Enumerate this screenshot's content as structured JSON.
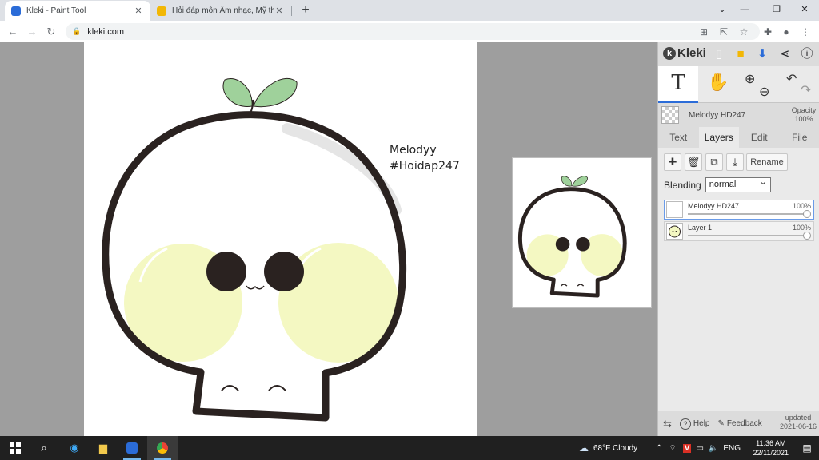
{
  "browser": {
    "tabs": [
      {
        "title": "Kleki - Paint Tool",
        "active": true,
        "favicon_color": "#2b6cd8"
      },
      {
        "title": "Hỏi đáp môn Âm nhạc, Mỹ thuật...",
        "active": false,
        "favicon_color": "#f2b705"
      }
    ],
    "url": "kleki.com"
  },
  "artwork": {
    "text_line1": "Melodyy",
    "text_line2": "#Hoidap247",
    "colors": {
      "outline": "#2a2220",
      "cheek": "#f4f8c2",
      "leaf": "#9fd19b",
      "eye": "#2a2220"
    }
  },
  "kleki": {
    "brand": "Kleki",
    "layer_name": "Melodyy HD247",
    "opacity_label": "Opacity",
    "opacity_value": "100%",
    "tabs": [
      "Text",
      "Layers",
      "Edit",
      "File"
    ],
    "active_tab": "Layers",
    "rename_label": "Rename",
    "blending_label": "Blending",
    "blending_value": "normal",
    "layers": [
      {
        "name": "Melodyy HD247",
        "opacity": "100%",
        "active": true
      },
      {
        "name": "Layer 1",
        "opacity": "100%",
        "active": false
      }
    ],
    "footer": {
      "help": "Help",
      "feedback": "Feedback",
      "updated_label": "updated",
      "updated_date": "2021-06-16"
    },
    "accent": "#2b6cd8"
  },
  "taskbar": {
    "weather": "68°F  Cloudy",
    "lang": "ENG",
    "time": "11:36 AM",
    "date": "22/11/2021"
  }
}
